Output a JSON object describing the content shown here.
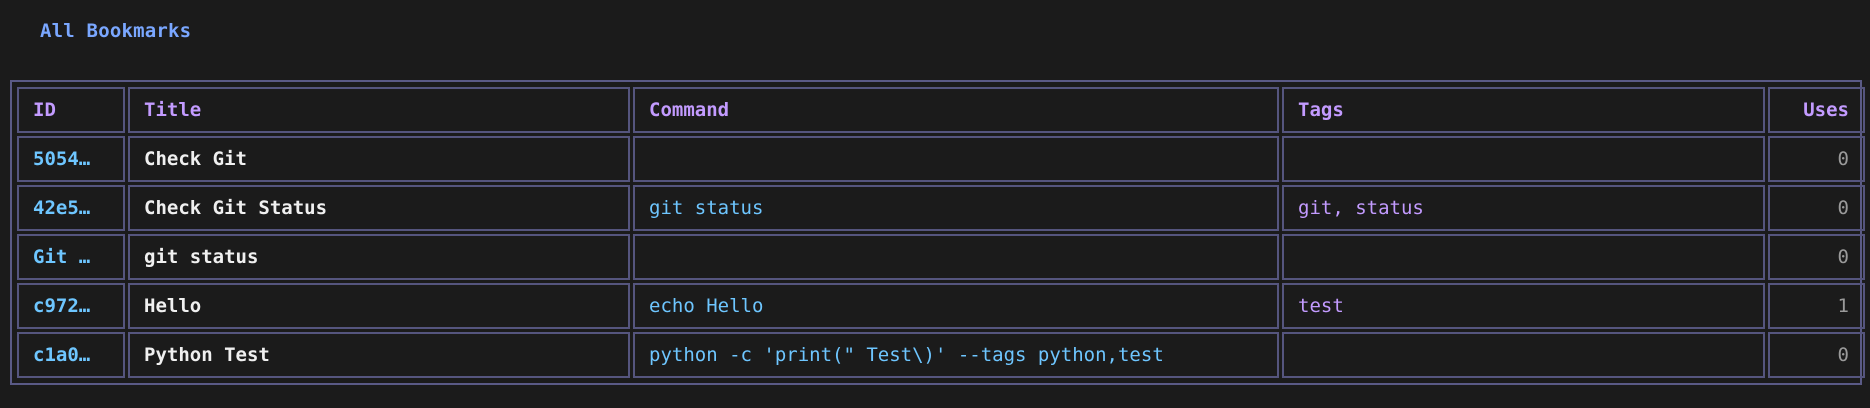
{
  "header": {
    "title": "All Bookmarks"
  },
  "table": {
    "columns": [
      "ID",
      "Title",
      "Command",
      "Tags",
      "Uses"
    ],
    "rows": [
      {
        "id": "5054…",
        "title": "Check Git",
        "command": "",
        "tags": "",
        "uses": "0"
      },
      {
        "id": "42e5…",
        "title": "Check Git Status",
        "command": "git status",
        "tags": "git, status",
        "uses": "0"
      },
      {
        "id": "Git …",
        "title": "git status",
        "command": "",
        "tags": "",
        "uses": "0"
      },
      {
        "id": "c972…",
        "title": "Hello",
        "command": "echo Hello",
        "tags": "test",
        "uses": "1"
      },
      {
        "id": "c1a0…",
        "title": "Python Test",
        "command": "python -c 'print(\" Test\\)' --tags python,test",
        "tags": "",
        "uses": "0"
      }
    ]
  },
  "colors": {
    "background": "#1b1b1b",
    "border": "#55557e",
    "heading": "#7aa7ff",
    "header_text": "#c39bff",
    "id_text": "#6ec6ff",
    "command_text": "#6ec6ff",
    "tags_text": "#c39bff"
  }
}
